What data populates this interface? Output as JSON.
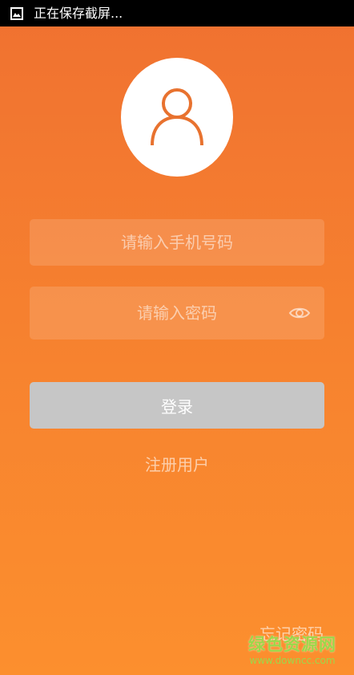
{
  "status_bar": {
    "icon": "screenshot-icon",
    "text": "正在保存截屏..."
  },
  "avatar": {
    "icon": "user-icon",
    "icon_color": "#e8722f"
  },
  "phone_field": {
    "placeholder": "请输入手机号码",
    "value": ""
  },
  "password_field": {
    "placeholder": "请输入密码",
    "value": "",
    "toggle_icon": "eye-icon"
  },
  "login_button": {
    "label": "登录",
    "color": "#c6c6c6"
  },
  "register_link": {
    "label": "注册用户"
  },
  "forgot_link": {
    "label": "忘记密码"
  },
  "watermark": {
    "title": "绿色资源网",
    "url": "www.downcc.com",
    "color": "#9bd84a"
  },
  "theme": {
    "gradient_top": "#f07130",
    "gradient_bottom": "#fc8f2e"
  }
}
